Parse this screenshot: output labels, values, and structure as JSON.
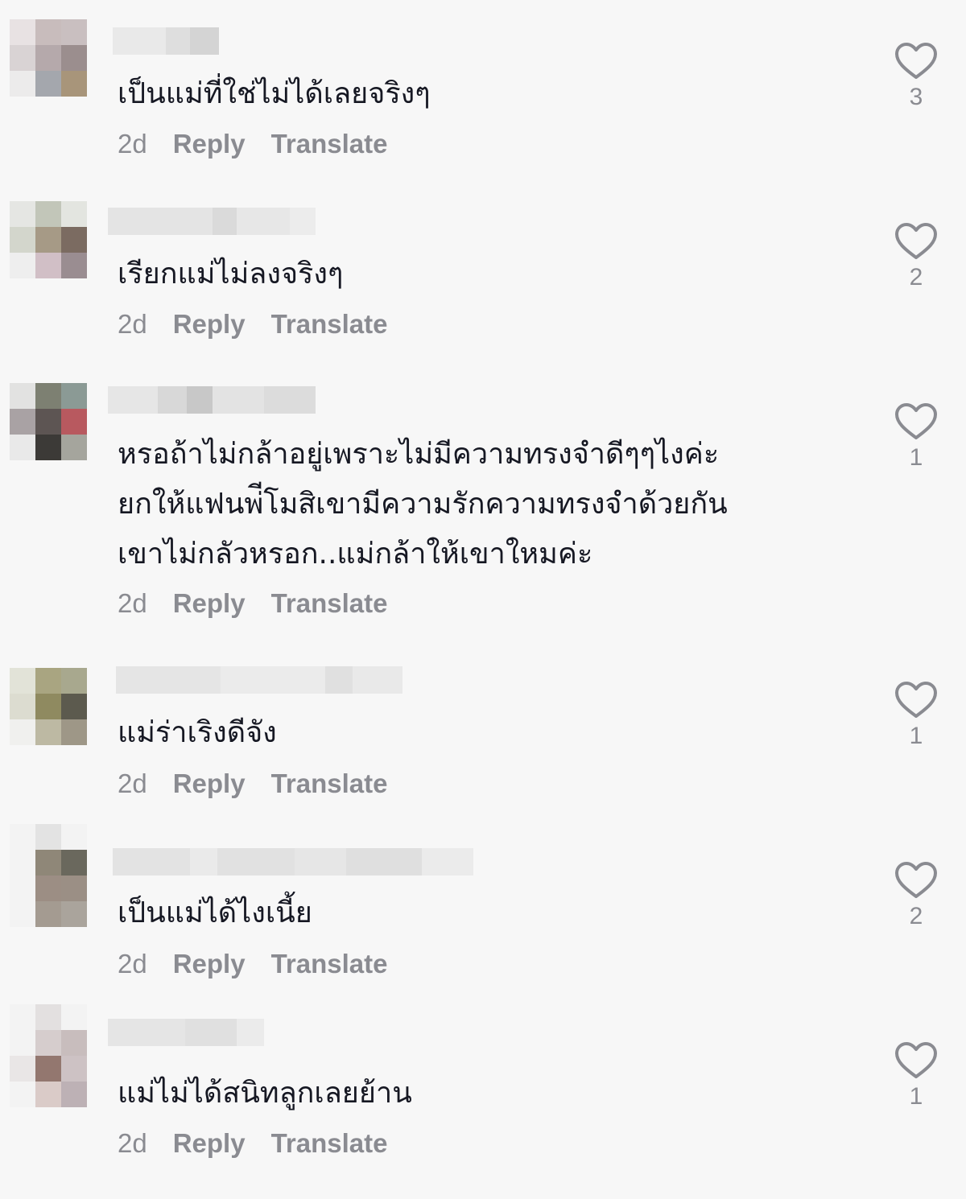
{
  "comments": [
    {
      "text_lines": [
        "เป็นแม่ที่ใช่ไม่ได้เลยจริงๆ"
      ],
      "time": "2d",
      "reply_label": "Reply",
      "translate_label": "Translate",
      "likes": "3",
      "icon": "heart-outline-icon"
    },
    {
      "text_lines": [
        "เรียกแม่ไม่ลงจริงๆ"
      ],
      "time": "2d",
      "reply_label": "Reply",
      "translate_label": "Translate",
      "likes": "2",
      "icon": "heart-outline-icon"
    },
    {
      "text_lines": [
        "หรอถ้าไม่กล้าอยู่เพราะไม่มีความทรงจำดีๆๆไงค่ะ",
        "ยกให้แฟนพ่ีโมสิเขามีความรักความทรงจำด้วยกัน",
        "เขาไม่กลัวหรอก..แม่กล้าให้เขาใหมค่ะ"
      ],
      "time": "2d",
      "reply_label": "Reply",
      "translate_label": "Translate",
      "likes": "1",
      "icon": "heart-outline-icon"
    },
    {
      "text_lines": [
        "แม่ร่าเริงดีจัง"
      ],
      "time": "2d",
      "reply_label": "Reply",
      "translate_label": "Translate",
      "likes": "1",
      "icon": "heart-outline-icon"
    },
    {
      "text_lines": [
        "เป็นแม่ได้ไงเนี้ย"
      ],
      "time": "2d",
      "reply_label": "Reply",
      "translate_label": "Translate",
      "likes": "2",
      "icon": "heart-outline-icon"
    },
    {
      "text_lines": [
        "แม่ไม่ได้สนิทลูกเลยย้าน"
      ],
      "time": "2d",
      "reply_label": "Reply",
      "translate_label": "Translate",
      "likes": "1",
      "icon": "heart-outline-icon"
    }
  ],
  "colors": {
    "text": "#161823",
    "meta": "#8a8b91",
    "background": "#f7f7f7",
    "heart": "#8a8b91"
  }
}
